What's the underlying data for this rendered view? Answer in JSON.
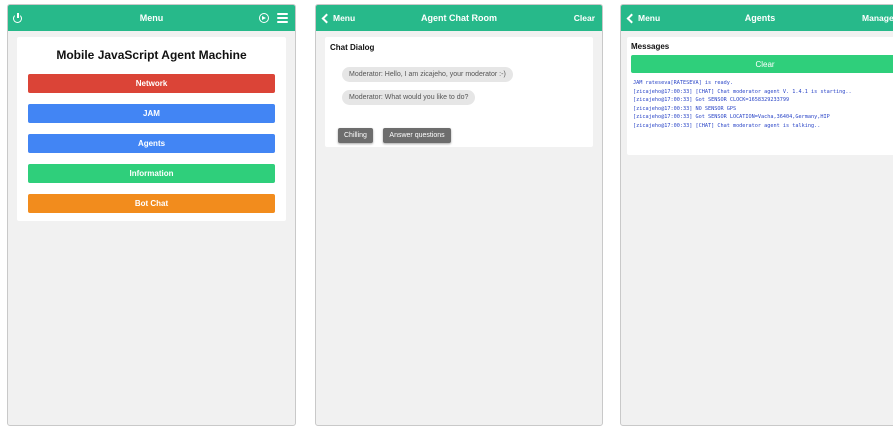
{
  "menu_panel": {
    "header_title": "Menu",
    "app_title": "Mobile JavaScript Agent Machine",
    "buttons": [
      {
        "label": "Network",
        "color": "#db4437"
      },
      {
        "label": "JAM",
        "color": "#4285f4"
      },
      {
        "label": "Agents",
        "color": "#4285f4"
      },
      {
        "label": "Information",
        "color": "#2fcf7b"
      },
      {
        "label": "Bot Chat",
        "color": "#f28c1d"
      }
    ],
    "icons": [
      "power-icon",
      "circle-arrow-icon",
      "hamburger-icon"
    ]
  },
  "chat_panel": {
    "back_label": "Menu",
    "header_title": "Agent Chat Room",
    "clear_label": "Clear",
    "section_title": "Chat Dialog",
    "messages": [
      "Moderator: Hello, I am zicajeho, your moderator :-)",
      "Moderator: What would you like to do?"
    ],
    "options": [
      "Chilling",
      "Answer questions"
    ]
  },
  "agents_panel": {
    "back_label": "Menu",
    "header_title": "Agents",
    "right_label": "Manager",
    "section_title": "Messages",
    "clear_label": "Clear",
    "log_lines": [
      "JAM rateseva[RATESEVA] is ready.",
      "[zicajeho@17:00:33] [CHAT] Chat moderator agent V. 1.4.1 is starting..",
      "[zicajeho@17:00:33] Got SENSOR CLOCK=1658329233799",
      "[zicajeho@17:00:33] NO SENSOR GPS",
      "[zicajeho@17:00:33] Got SENSOR LOCATION=Vacha,36404,Germany,HIP",
      "[zicajeho@17:00:33] [CHAT] Chat moderator agent is talking.."
    ]
  },
  "colors": {
    "header": "#27b98a",
    "panel_bg": "#f1f1f1",
    "log_text": "#2a45c7"
  }
}
